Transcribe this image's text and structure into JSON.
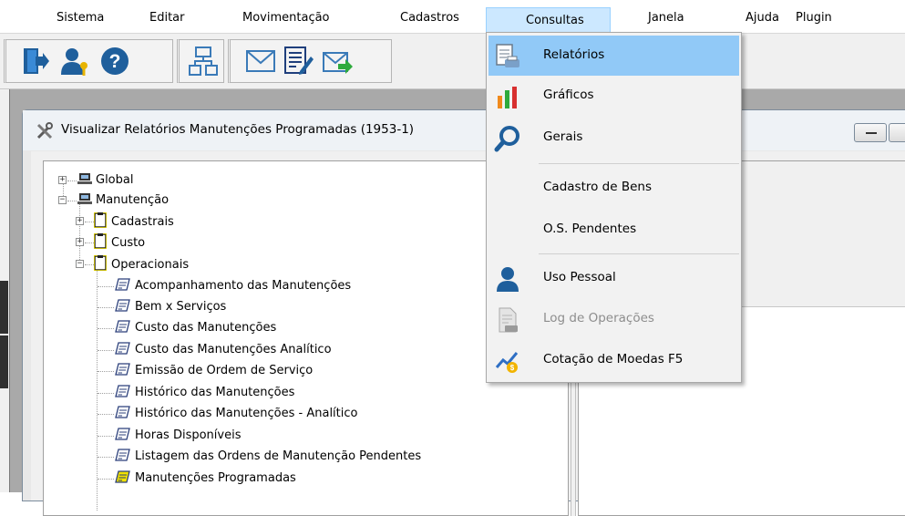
{
  "menubar": {
    "items": [
      "Sistema",
      "Editar",
      "Movimentação",
      "Cadastros",
      "Consultas",
      "Janela",
      "Ajuda",
      "Plugin"
    ]
  },
  "toolbar": {
    "buttons": [
      {
        "icon": "exit-door-icon"
      },
      {
        "icon": "user-key-icon"
      },
      {
        "icon": "help-icon"
      },
      {
        "icon": "org-chart-icon"
      },
      {
        "icon": "envelope-icon"
      },
      {
        "icon": "edit-document-icon"
      },
      {
        "icon": "send-mail-icon"
      }
    ]
  },
  "child_window": {
    "title": "Visualizar Relatórios Manutenções Programadas (1953-1)"
  },
  "tree": {
    "global": "Global",
    "manutencao": "Manutenção",
    "cadastrais": "Cadastrais",
    "custo": "Custo",
    "operacionais": "Operacionais",
    "reports": [
      "Acompanhamento das Manutenções",
      "Bem x Serviços",
      "Custo das Manutenções",
      "Custo das Manutenções Analítico",
      "Emissão de Ordem de Serviço",
      "Histórico das Manutenções",
      "Histórico das Manutenções - Analítico",
      "Horas Disponíveis",
      "Listagem das Ordens de Manutenção Pendentes",
      "Manutenções Programadas"
    ]
  },
  "consultas_menu": {
    "relatorios": "Relatórios",
    "graficos": "Gráficos",
    "gerais": "Gerais",
    "cadastro_bens": "Cadastro de Bens",
    "os_pendentes": "O.S. Pendentes",
    "uso_pessoal": "Uso Pessoal",
    "log_operacoes": "Log de Operações",
    "cotacao_moedas": "Cotação de Moedas F5"
  },
  "colors": {
    "menu_highlight": "#91c9f7",
    "open_menu_title": "#cce8ff",
    "folder_yellow": "#f2e200"
  }
}
